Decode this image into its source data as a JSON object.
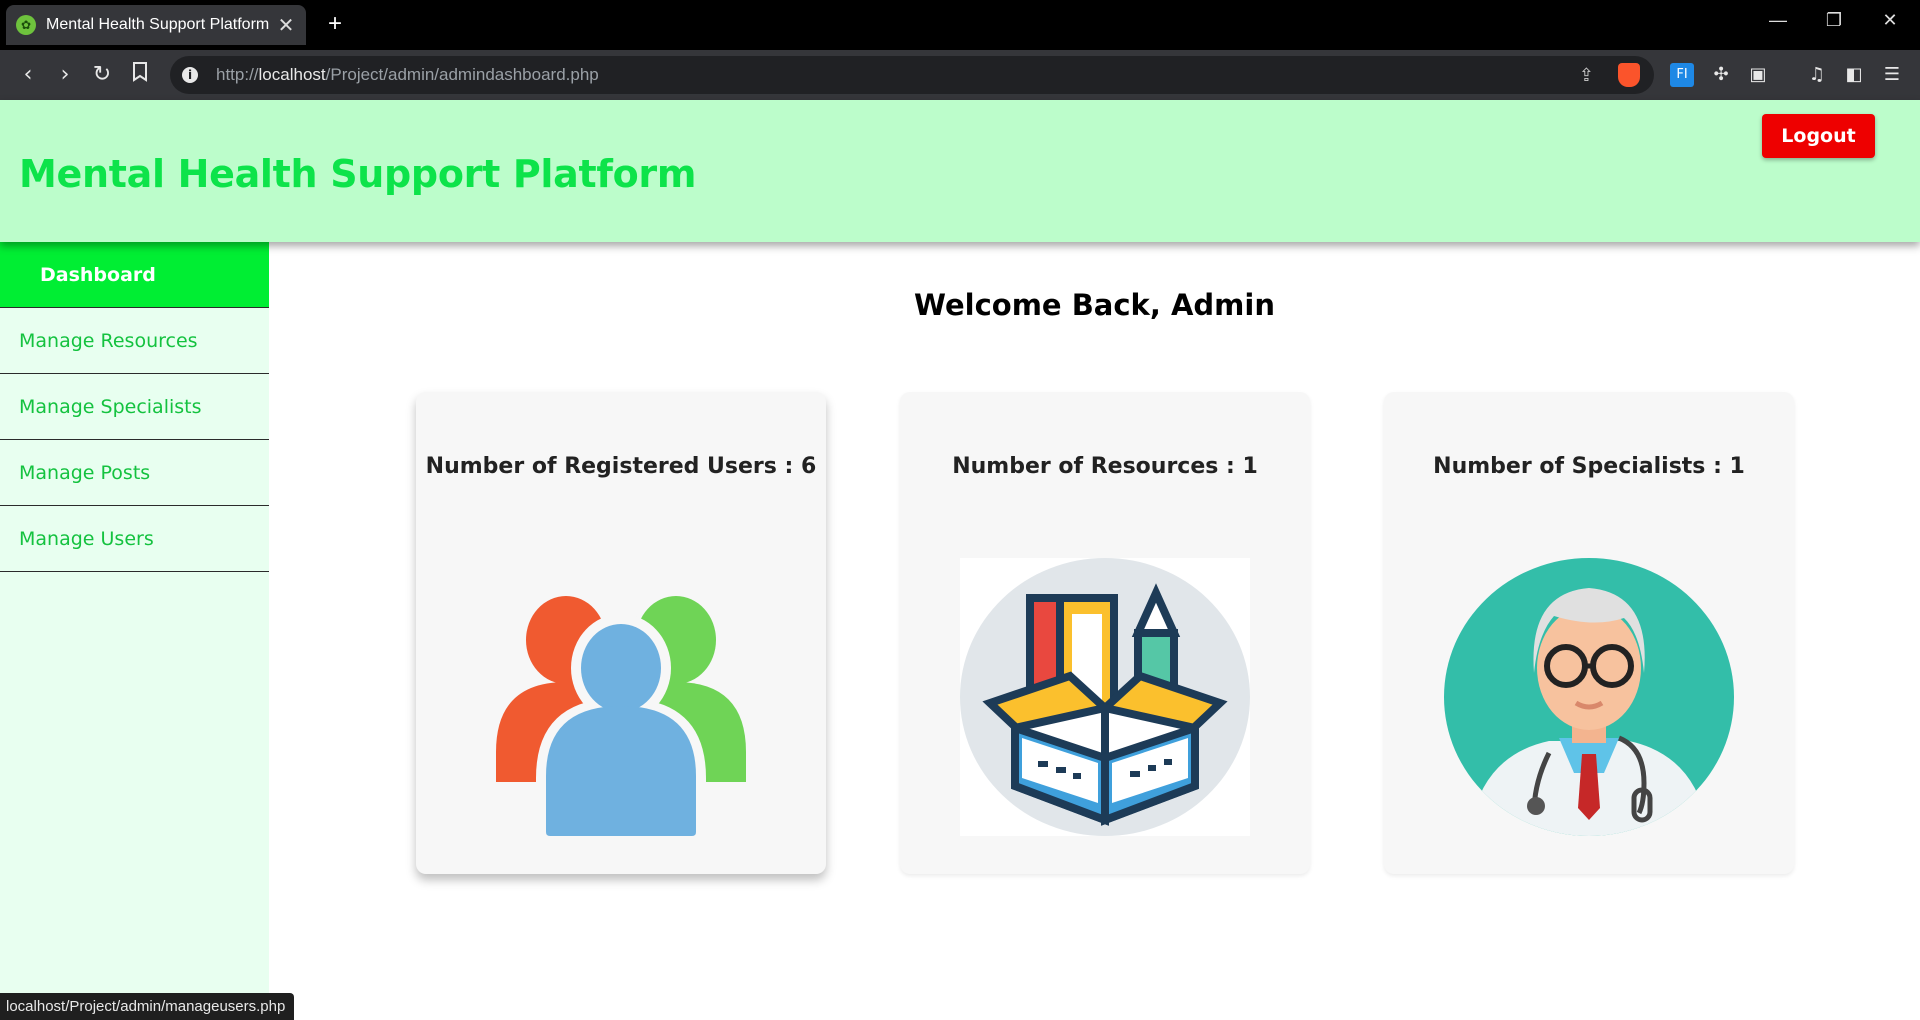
{
  "browser": {
    "tab_title": "Mental Health Support Platform",
    "tab_close": "✕",
    "new_tab": "+",
    "url_scheme": "http://",
    "url_host": "localhost",
    "url_path": "/Project/admin/admindashboard.php",
    "status_url": "localhost/Project/admin/manageusers.php",
    "icons": [
      "back-icon",
      "forward-icon",
      "reload-icon",
      "bookmark-icon",
      "share-icon",
      "brave-shield-icon",
      "translate-icon",
      "extensions-icon",
      "reading-list-icon",
      "media-icon",
      "sidebar-icon",
      "menu-icon"
    ]
  },
  "header": {
    "title": "Mental Health Support Platform",
    "logout_label": "Logout",
    "background": "#bcfdcb",
    "title_color": "#0de34a",
    "logout_color": "#ee0000"
  },
  "sidebar": {
    "items": [
      {
        "label": "Dashboard",
        "active": true
      },
      {
        "label": "Manage Resources",
        "active": false
      },
      {
        "label": "Manage Specialists",
        "active": false
      },
      {
        "label": "Manage Posts",
        "active": false
      },
      {
        "label": "Manage Users",
        "active": false
      }
    ]
  },
  "main": {
    "welcome": "Welcome Back, Admin",
    "cards": [
      {
        "label": "Number of Registered Users : 6",
        "icon": "users-group-icon"
      },
      {
        "label": "Number of Resources : 1",
        "icon": "resources-box-icon"
      },
      {
        "label": "Number of Specialists : 1",
        "icon": "doctor-icon"
      }
    ]
  }
}
